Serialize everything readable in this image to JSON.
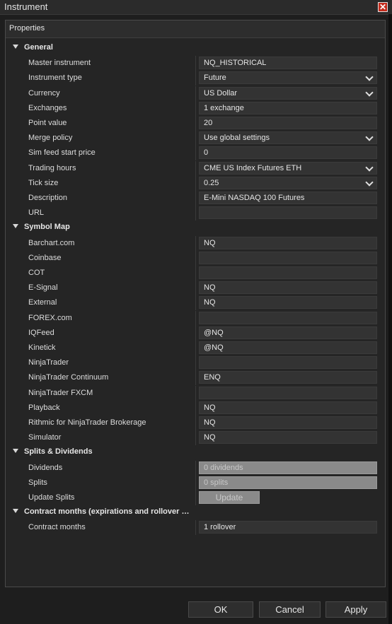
{
  "window": {
    "title": "Instrument",
    "close_glyph": "✕"
  },
  "panel": {
    "header": "Properties"
  },
  "sections": [
    {
      "label": "General",
      "rows": [
        {
          "label": "Master instrument",
          "value": "NQ_HISTORICAL",
          "type": "text"
        },
        {
          "label": "Instrument type",
          "value": "Future",
          "type": "select"
        },
        {
          "label": "Currency",
          "value": "US Dollar",
          "type": "select"
        },
        {
          "label": "Exchanges",
          "value": "1 exchange",
          "type": "text"
        },
        {
          "label": "Point value",
          "value": "20",
          "type": "text"
        },
        {
          "label": "Merge policy",
          "value": "Use global settings",
          "type": "select"
        },
        {
          "label": "Sim feed start price",
          "value": "0",
          "type": "text"
        },
        {
          "label": "Trading hours",
          "value": "CME US Index Futures ETH",
          "type": "select"
        },
        {
          "label": "Tick size",
          "value": "0.25",
          "type": "select"
        },
        {
          "label": "Description",
          "value": "E-Mini NASDAQ 100 Futures",
          "type": "text"
        },
        {
          "label": "URL",
          "value": "",
          "type": "text"
        }
      ]
    },
    {
      "label": "Symbol Map",
      "rows": [
        {
          "label": "Barchart.com",
          "value": "NQ",
          "type": "text"
        },
        {
          "label": "Coinbase",
          "value": "",
          "type": "text"
        },
        {
          "label": "COT",
          "value": "",
          "type": "text"
        },
        {
          "label": "E-Signal",
          "value": "NQ",
          "type": "text"
        },
        {
          "label": "External",
          "value": "NQ",
          "type": "text"
        },
        {
          "label": "FOREX.com",
          "value": "",
          "type": "text"
        },
        {
          "label": "IQFeed",
          "value": "@NQ",
          "type": "text"
        },
        {
          "label": "Kinetick",
          "value": "@NQ",
          "type": "text"
        },
        {
          "label": "NinjaTrader",
          "value": "",
          "type": "text"
        },
        {
          "label": "NinjaTrader Continuum",
          "value": "ENQ",
          "type": "text"
        },
        {
          "label": "NinjaTrader FXCM",
          "value": "",
          "type": "text"
        },
        {
          "label": "Playback",
          "value": "NQ",
          "type": "text"
        },
        {
          "label": "Rithmic for NinjaTrader Brokerage",
          "value": "NQ",
          "type": "text"
        },
        {
          "label": "Simulator",
          "value": "NQ",
          "type": "text"
        }
      ]
    },
    {
      "label": "Splits & Dividends",
      "rows": [
        {
          "label": "Dividends",
          "value": "0 dividends",
          "type": "disabled"
        },
        {
          "label": "Splits",
          "value": "0 splits",
          "type": "disabled"
        },
        {
          "label": "Update Splits",
          "value": "Update",
          "type": "button"
        }
      ]
    },
    {
      "label": "Contract months (expirations and rollover da...",
      "rows": [
        {
          "label": "Contract months",
          "value": "1 rollover",
          "type": "text"
        }
      ]
    }
  ],
  "footer": {
    "ok": "OK",
    "cancel": "Cancel",
    "apply": "Apply"
  },
  "colors": {
    "background": "#1e1e1e",
    "field": "#333333",
    "close": "#c42b1c"
  }
}
